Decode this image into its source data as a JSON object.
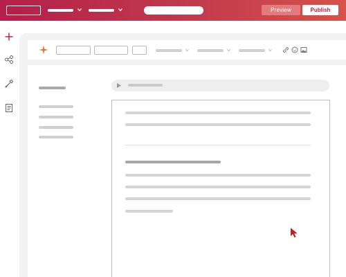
{
  "header": {
    "menus": [
      {
        "name": "menu-one"
      },
      {
        "name": "menu-two"
      }
    ],
    "preview_label": "Preview",
    "publish_label": "Publish"
  },
  "sidebar": {
    "icons": [
      "add-icon",
      "share-nodes-icon",
      "brush-icon",
      "document-icon"
    ]
  },
  "toolbar": {
    "icons": [
      "link-icon",
      "emoji-icon",
      "image-icon"
    ]
  },
  "colors": {
    "brand_gradient_start": "#b51f4a",
    "brand_gradient_end": "#d6524a",
    "accent": "#b3213e",
    "preview_button": "#e27b7e",
    "spark_orange": "#e8732c",
    "cursor": "#b3262a"
  }
}
